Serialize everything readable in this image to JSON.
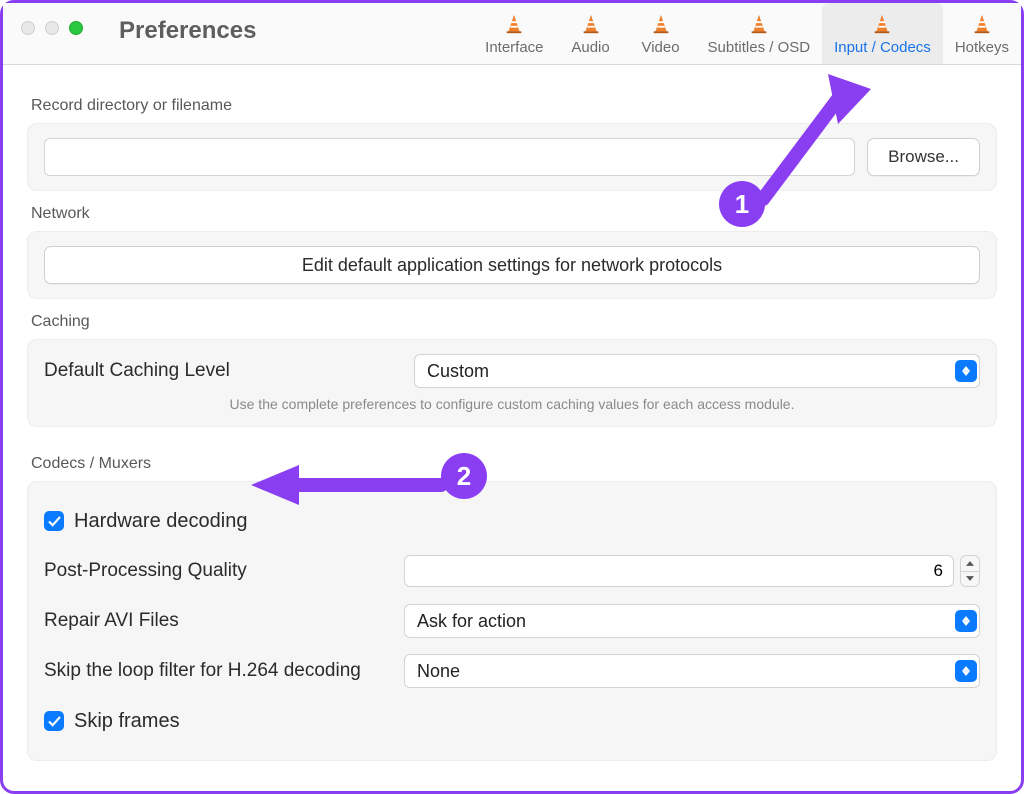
{
  "title": "Preferences",
  "tabs": {
    "interface": "Interface",
    "audio": "Audio",
    "video": "Video",
    "subtitles": "Subtitles / OSD",
    "input_codecs": "Input / Codecs",
    "hotkeys": "Hotkeys"
  },
  "record": {
    "label": "Record directory or filename",
    "value": "",
    "browse": "Browse..."
  },
  "network": {
    "label": "Network",
    "button": "Edit default application settings for network protocols"
  },
  "caching": {
    "label": "Caching",
    "row_label": "Default Caching Level",
    "value": "Custom",
    "help": "Use the complete preferences to configure custom caching values for each access module."
  },
  "codecs": {
    "label": "Codecs / Muxers",
    "hw_decoding": "Hardware decoding",
    "ppq_label": "Post-Processing Quality",
    "ppq_value": "6",
    "repair_label": "Repair AVI Files",
    "repair_value": "Ask for action",
    "skiploop_label": "Skip the loop filter for H.264 decoding",
    "skiploop_value": "None",
    "skipframes": "Skip frames"
  },
  "annotations": {
    "one": "1",
    "two": "2"
  }
}
